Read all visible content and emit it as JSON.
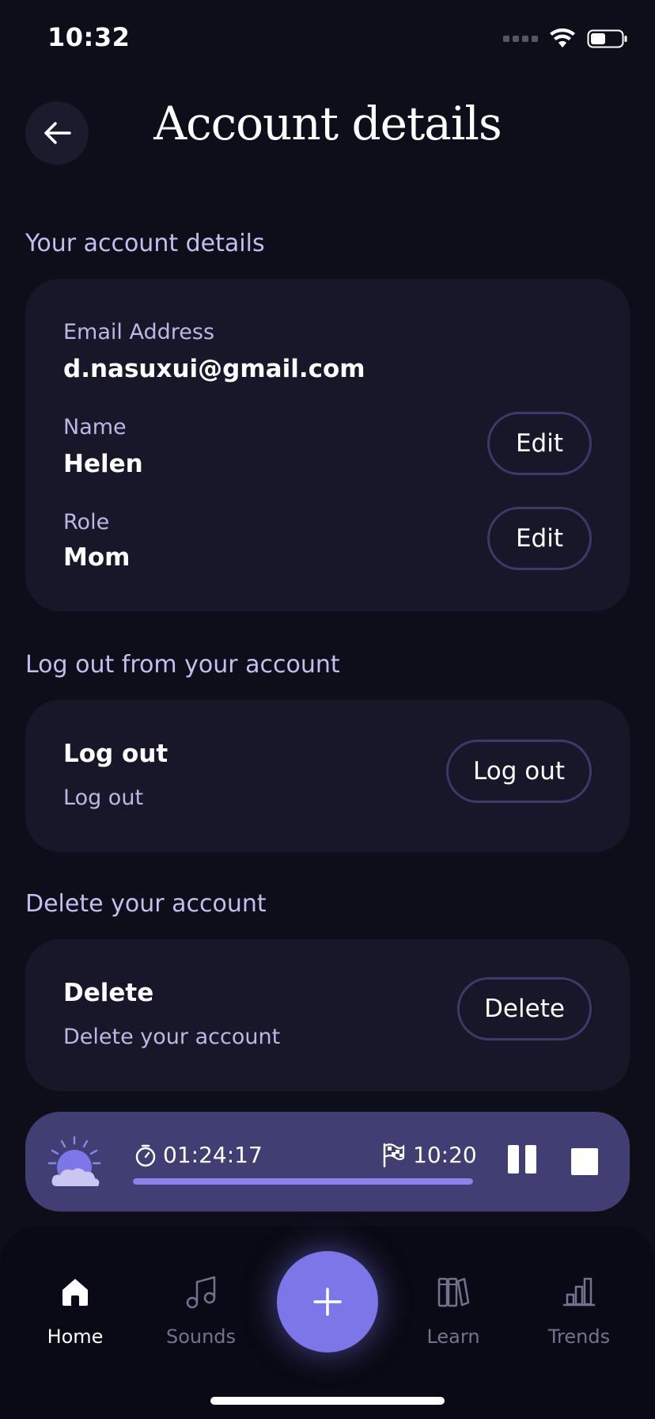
{
  "status_bar": {
    "time": "10:32"
  },
  "header": {
    "title": "Account details"
  },
  "sections": {
    "account": {
      "title": "Your account details",
      "email_label": "Email Address",
      "email_value": "d.nasuxui@gmail.com",
      "name_label": "Name",
      "name_value": "Helen",
      "name_edit": "Edit",
      "role_label": "Role",
      "role_value": "Mom",
      "role_edit": "Edit"
    },
    "logout": {
      "title": "Log out from your account",
      "heading": "Log out",
      "subtext": "Log out",
      "button": "Log out"
    },
    "delete": {
      "title": "Delete your account",
      "heading": "Delete",
      "subtext": "Delete your account",
      "button": "Delete"
    }
  },
  "player": {
    "elapsed": "01:24:17",
    "goal": "10:20",
    "progress": 1.0,
    "icon": "sun-cloud-icon"
  },
  "tabbar": {
    "items": [
      {
        "label": "Home",
        "icon": "home-icon",
        "active": true
      },
      {
        "label": "Sounds",
        "icon": "music-note-icon",
        "active": false
      },
      {
        "label": "Learn",
        "icon": "books-icon",
        "active": false
      },
      {
        "label": "Trends",
        "icon": "bar-chart-icon",
        "active": false
      }
    ],
    "add_icon": "plus-icon"
  },
  "colors": {
    "background": "#0e0e1b",
    "card": "#171729",
    "accent": "#7d76e8",
    "player": "#403e72",
    "section_title": "#c4bdf0"
  }
}
